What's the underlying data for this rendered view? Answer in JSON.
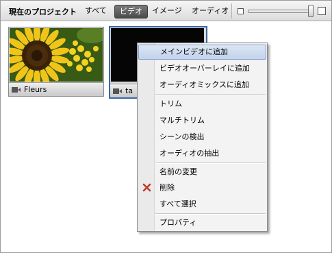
{
  "toolbar": {
    "title": "現在のプロジェクト",
    "filters": [
      {
        "label": "すべて",
        "active": false
      },
      {
        "label": "ビデオ",
        "active": true
      },
      {
        "label": "イメージ",
        "active": false
      },
      {
        "label": "オーディオ",
        "active": false
      }
    ],
    "zoom_slider_level": 0.95
  },
  "media": [
    {
      "name": "Fleurs",
      "type_icon": "video-camera-icon",
      "selected": false
    },
    {
      "name": "ta",
      "type_icon": "video-camera-icon",
      "selected": true
    }
  ],
  "context_menu": {
    "items": [
      {
        "label": "メインビデオに追加",
        "highlighted": true
      },
      {
        "label": "ビデオオーバーレイに追加"
      },
      {
        "label": "オーディオミックスに追加"
      },
      {
        "label": "トリム"
      },
      {
        "label": "マルチトリム"
      },
      {
        "label": "シーンの検出"
      },
      {
        "label": "オーディオの抽出"
      },
      {
        "label": "名前の変更"
      },
      {
        "label": "削除",
        "icon": "delete-x-icon"
      },
      {
        "label": "すべて選択"
      },
      {
        "label": "プロパティ"
      }
    ]
  },
  "colors": {
    "selection_border": "#3b67a8",
    "delete_icon": "#c0392b",
    "active_filter": "#4a4a4a"
  }
}
